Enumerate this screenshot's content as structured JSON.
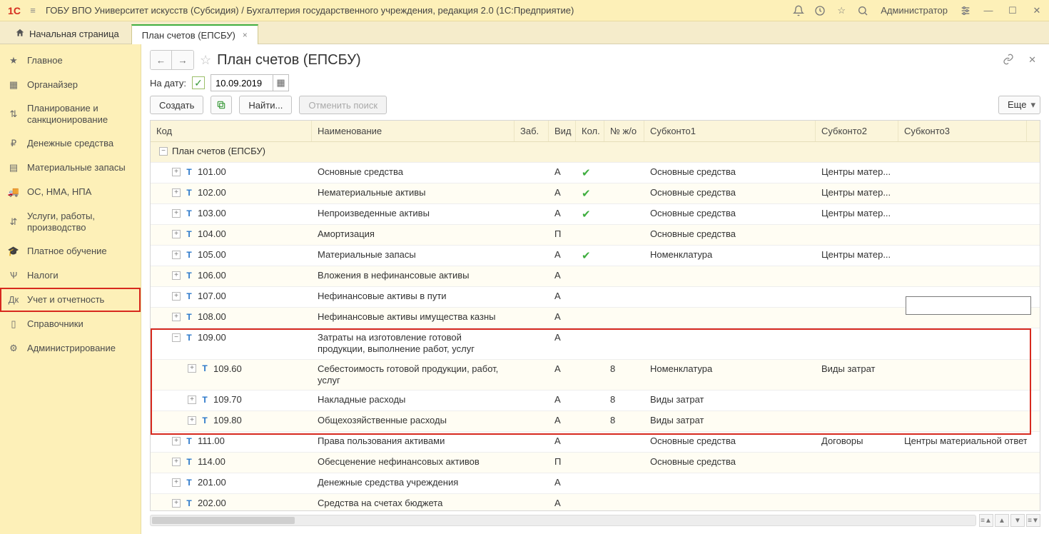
{
  "app_title": "ГОБУ ВПО Университет искусств (Субсидия) / Бухгалтерия государственного учреждения, редакция 2.0  (1С:Предприятие)",
  "user_name": "Администратор",
  "tabs": [
    {
      "label": "Начальная страница",
      "active": false,
      "has_home": true
    },
    {
      "label": "План счетов (ЕПСБУ)",
      "active": true,
      "has_close": true
    }
  ],
  "sidebar": {
    "items": [
      {
        "label": "Главное"
      },
      {
        "label": "Органайзер"
      },
      {
        "label": "Планирование и санкционирование"
      },
      {
        "label": "Денежные средства"
      },
      {
        "label": "Материальные запасы"
      },
      {
        "label": "ОС, НМА, НПА"
      },
      {
        "label": "Услуги, работы, производство"
      },
      {
        "label": "Платное обучение"
      },
      {
        "label": "Налоги"
      },
      {
        "label": "Учет и отчетность",
        "highlight": true
      },
      {
        "label": "Справочники"
      },
      {
        "label": "Администрирование"
      }
    ]
  },
  "page": {
    "title": "План счетов (ЕПСБУ)",
    "date_label": "На дату:",
    "date_value": "10.09.2019",
    "actions": {
      "create": "Создать",
      "find": "Найти...",
      "cancel_search": "Отменить поиск",
      "more": "Еще"
    },
    "columns": {
      "code": "Код",
      "name": "Наименование",
      "zab": "Заб.",
      "vid": "Вид",
      "kol": "Кол.",
      "jo": "№ ж/о",
      "s1": "Субконто1",
      "s2": "Субконто2",
      "s3": "Субконто3"
    },
    "group_label": "План счетов (ЕПСБУ)",
    "rows": [
      {
        "code": "101.00",
        "name": "Основные средства",
        "vid": "А",
        "kol": true,
        "s1": "Основные средства",
        "s2": "Центры матер...",
        "ind": 1
      },
      {
        "code": "102.00",
        "name": "Нематериальные активы",
        "vid": "А",
        "kol": true,
        "s1": "Основные средства",
        "s2": "Центры матер...",
        "ind": 1
      },
      {
        "code": "103.00",
        "name": "Непроизведенные активы",
        "vid": "А",
        "kol": true,
        "s1": "Основные средства",
        "s2": "Центры матер...",
        "ind": 1
      },
      {
        "code": "104.00",
        "name": "Амортизация",
        "vid": "П",
        "s1": "Основные средства",
        "ind": 1
      },
      {
        "code": "105.00",
        "name": "Материальные запасы",
        "vid": "А",
        "kol": true,
        "s1": "Номенклатура",
        "s2": "Центры матер...",
        "ind": 1
      },
      {
        "code": "106.00",
        "name": "Вложения в нефинансовые активы",
        "vid": "А",
        "ind": 1
      },
      {
        "code": "107.00",
        "name": "Нефинансовые активы в пути",
        "vid": "А",
        "ind": 1
      },
      {
        "code": "108.00",
        "name": "Нефинансовые активы имущества казны",
        "vid": "А",
        "ind": 1
      },
      {
        "code": "109.00",
        "name": "Затраты на изготовление готовой продукции, выполнение работ, услуг",
        "vid": "А",
        "ind": 1,
        "expanded": true
      },
      {
        "code": "109.60",
        "name": "Себестоимость готовой продукции, работ, услуг",
        "vid": "А",
        "jo": "8",
        "s1": "Номенклатура",
        "s2": "Виды затрат",
        "ind": 2
      },
      {
        "code": "109.70",
        "name": "Накладные расходы",
        "vid": "А",
        "jo": "8",
        "s1": "Виды затрат",
        "ind": 2
      },
      {
        "code": "109.80",
        "name": "Общехозяйственные расходы",
        "vid": "А",
        "jo": "8",
        "s1": "Виды затрат",
        "ind": 2
      },
      {
        "code": "111.00",
        "name": "Права пользования активами",
        "vid": "А",
        "s1": "Основные средства",
        "s2": "Договоры",
        "s3": "Центры материальной ответс",
        "ind": 1
      },
      {
        "code": "114.00",
        "name": "Обесценение нефинансовых активов",
        "vid": "П",
        "s1": "Основные средства",
        "ind": 1
      },
      {
        "code": "201.00",
        "name": "Денежные средства учреждения",
        "vid": "А",
        "ind": 1
      },
      {
        "code": "202.00",
        "name": "Средства на счетах бюджета",
        "vid": "А",
        "ind": 1
      }
    ]
  }
}
